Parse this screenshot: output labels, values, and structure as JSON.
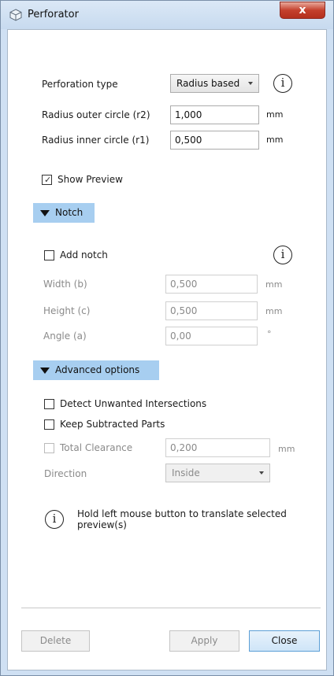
{
  "window": {
    "title": "Perforator",
    "close_glyph": "x"
  },
  "perforation": {
    "type_label": "Perforation type",
    "type_value": "Radius based",
    "outer_label": "Radius outer circle (r2)",
    "outer_value": "1,000",
    "outer_unit": "mm",
    "inner_label": "Radius inner circle (r1)",
    "inner_value": "0,500",
    "inner_unit": "mm",
    "info_glyph": "i"
  },
  "preview": {
    "label": "Show Preview",
    "checked": true,
    "tick": "✓"
  },
  "notch": {
    "header": "Notch",
    "add_label": "Add notch",
    "info_glyph": "i",
    "width_label": "Width (b)",
    "width_value": "0,500",
    "width_unit": "mm",
    "height_label": "Height (c)",
    "height_value": "0,500",
    "height_unit": "mm",
    "angle_label": "Angle (a)",
    "angle_value": "0,00",
    "angle_unit": "°"
  },
  "advanced": {
    "header": "Advanced options",
    "detect_label": "Detect Unwanted Intersections",
    "keep_label": "Keep Subtracted Parts",
    "clearance_label": "Total Clearance",
    "clearance_value": "0,200",
    "clearance_unit": "mm",
    "direction_label": "Direction",
    "direction_value": "Inside"
  },
  "hint": {
    "info_glyph": "i",
    "text": "Hold left mouse button to translate selected preview(s)"
  },
  "buttons": {
    "delete": "Delete",
    "apply": "Apply",
    "close": "Close"
  },
  "icons": {
    "title_icon": "cube-icon",
    "info_icon": "info-icon",
    "dropdown_icon": "chevron-down-icon",
    "collapse_icon": "triangle-down-icon"
  },
  "colors": {
    "section_bg": "#a7cef0",
    "frame": "#cfe0f3",
    "close_button": "#c4402c"
  }
}
